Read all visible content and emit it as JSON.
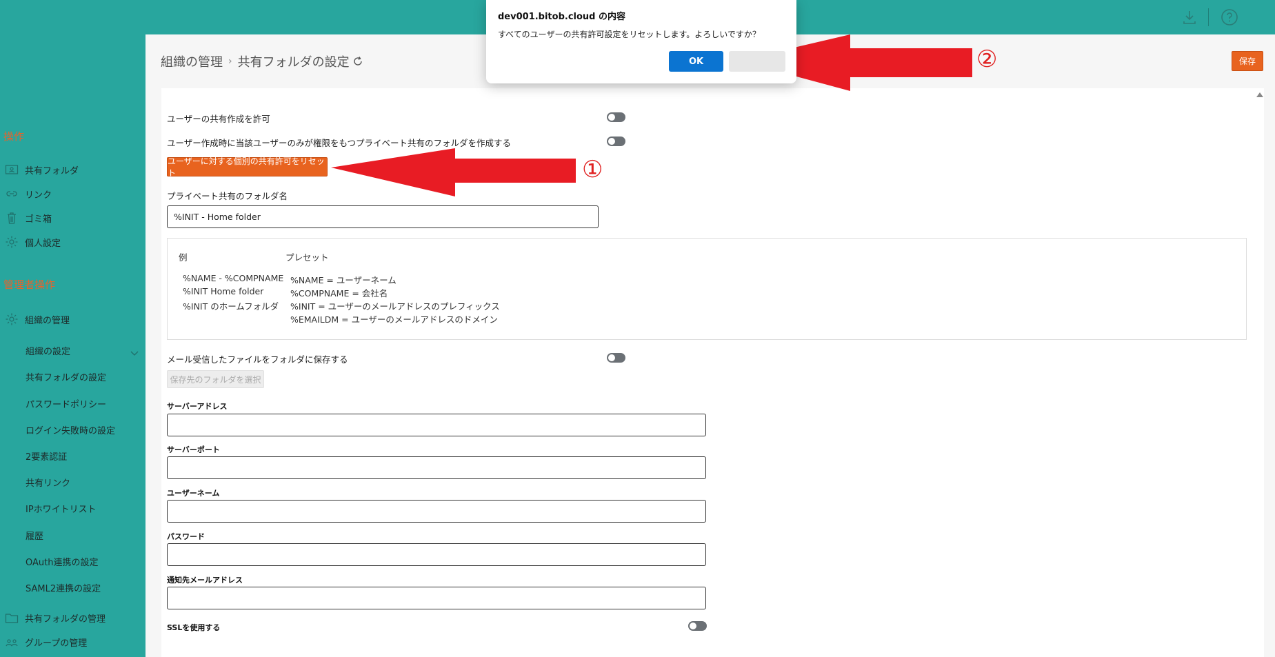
{
  "dialog": {
    "title": "dev001.bitob.cloud の内容",
    "message": "すべてのユーザーの共有許可設定をリセットします。よろしいですか？",
    "ok_label": "OK"
  },
  "topbar": {
    "icons": [
      "download-icon",
      "help-icon"
    ]
  },
  "sidebar": {
    "section_ops": "操作",
    "ops_items": [
      {
        "label": "共有フォルダ",
        "icon": "shared-folder-icon"
      },
      {
        "label": "リンク",
        "icon": "link-icon"
      },
      {
        "label": "ゴミ箱",
        "icon": "trash-icon"
      },
      {
        "label": "個人設定",
        "icon": "gear-icon"
      }
    ],
    "section_admin": "管理者操作",
    "org_item": {
      "label": "組織の管理",
      "icon": "gear-icon"
    },
    "org_subitems": [
      "組織の設定",
      "共有フォルダの設定",
      "パスワードポリシー",
      "ログイン失敗時の設定",
      "2要素認証",
      "共有リンク",
      "IPホワイトリスト",
      "履歴",
      "OAuth連携の設定",
      "SAML2連携の設定"
    ],
    "folder_mgmt": {
      "label": "共有フォルダの管理",
      "icon": "folder-icon"
    },
    "group_mgmt": {
      "label": "グループの管理",
      "icon": "group-icon"
    }
  },
  "breadcrumb": {
    "parent": "組織の管理",
    "separator": "›",
    "current": "共有フォルダの設定"
  },
  "save_label": "保存",
  "settings": {
    "allow_user_share": "ユーザーの共有作成を許可",
    "private_folder_on_create": "ユーザー作成時に当該ユーザーのみが権限をもつプライベート共有のフォルダを作成する",
    "reset_button": "ユーザーに対する個別の共有許可をリセット",
    "private_folder_name_label": "プライベート共有のフォルダ名",
    "private_folder_name_value": "%INIT - Home folder",
    "example_header": "例",
    "preset_header": "プレセット",
    "examples": [
      "%NAME - %COMPNAME",
      "%INIT Home folder",
      "%INIT のホームフォルダ"
    ],
    "presets": [
      "%NAME = ユーザーネーム",
      "%COMPNAME = 会社名",
      "%INIT = ユーザーのメールアドレスのプレフィックス",
      "%EMAILDM = ユーザーのメールアドレスのドメイン"
    ],
    "mail_save_label": "メール受信したファイルをフォルダに保存する",
    "select_folder_button": "保存先のフォルダを選択",
    "server_address_label": "サーバーアドレス",
    "server_port_label": "サーバーポート",
    "username_label": "ユーザーネーム",
    "password_label": "パスワード",
    "notify_email_label": "通知先メールアドレス",
    "ssl_label": "SSLを使用する"
  },
  "annotations": {
    "marker_1": "①",
    "marker_2": "②",
    "arrow_color": "#e81c24"
  }
}
